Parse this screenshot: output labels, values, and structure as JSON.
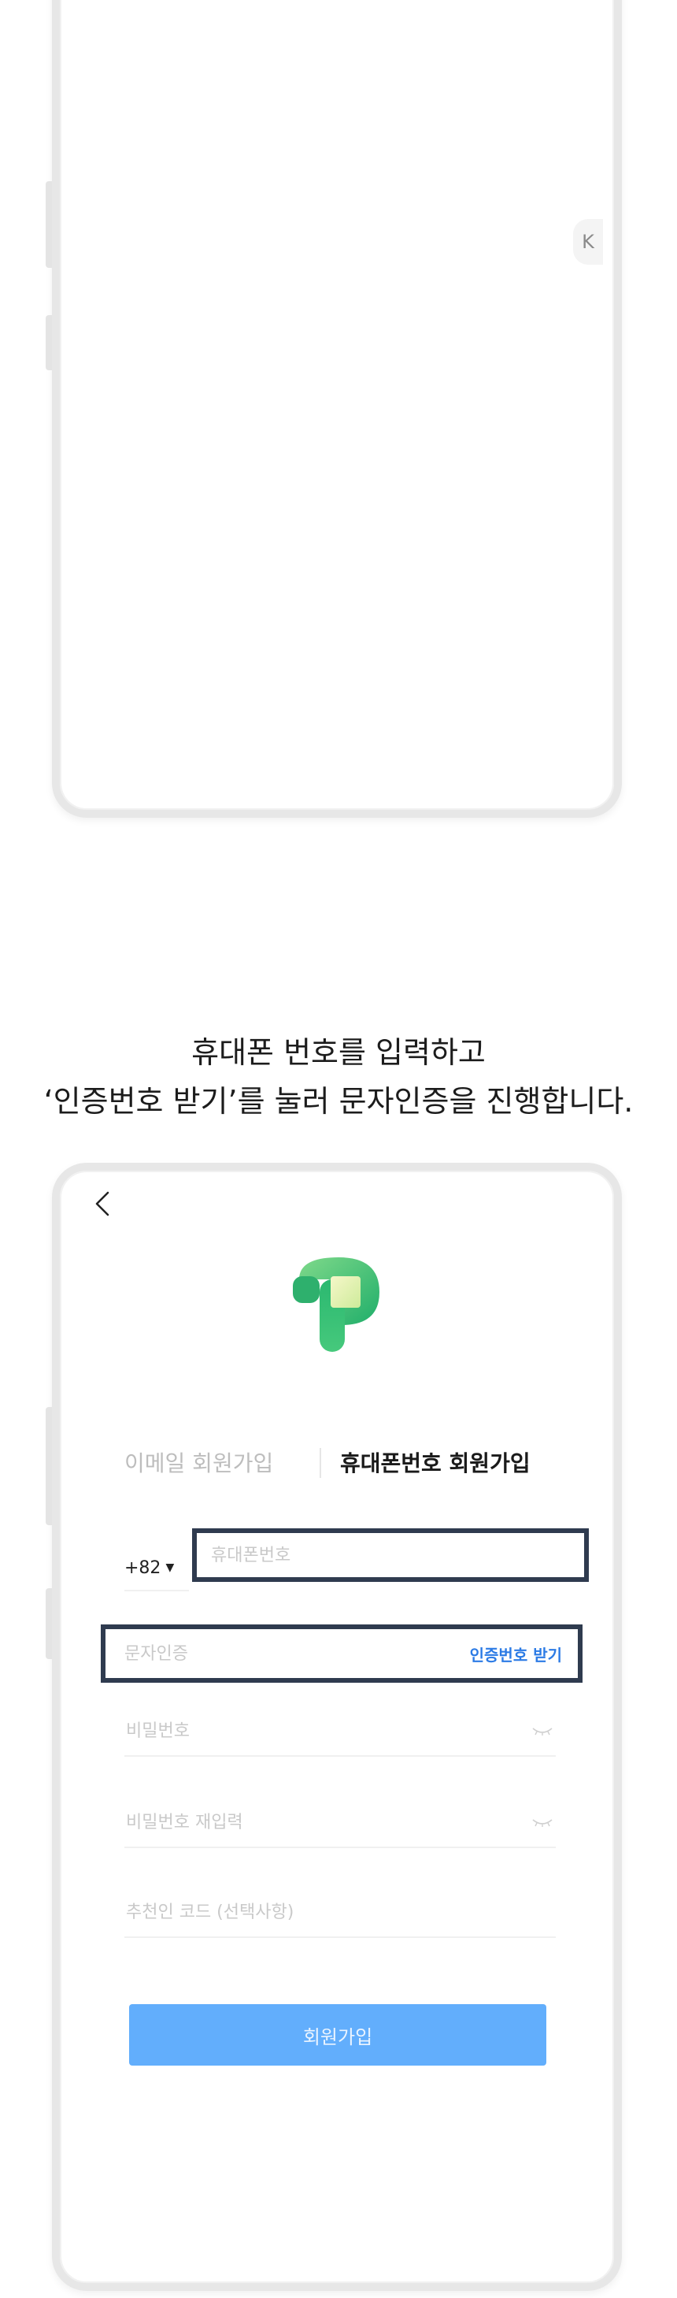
{
  "top_phone": {
    "side_tab_label": "K"
  },
  "caption": {
    "line1": "휴대폰 번호를 입력하고",
    "line2": "‘인증번호 받기’를 눌러 문자인증을 진행합니다."
  },
  "signup": {
    "tabs": {
      "email_label": "이메일 회원가입",
      "phone_label": "휴대폰번호 회원가입",
      "active": "phone"
    },
    "country_code": "+82",
    "phone_placeholder": "휴대폰번호",
    "sms_placeholder": "문자인증",
    "sms_button": "인증번호 받기",
    "password_placeholder": "비밀번호",
    "password_confirm_placeholder": "비밀번호 재입력",
    "referral_placeholder": "추천인 코드 (선택사항)",
    "submit_label": "회원가입"
  },
  "colors": {
    "accent_blue": "#2c7be5",
    "submit_bg": "#62aefc",
    "highlight_border": "#2f3b4f",
    "logo_green": "#3fbf73"
  },
  "icons": [
    "back-arrow-icon",
    "app-logo-icon",
    "caret-down-icon",
    "eye-closed-icon"
  ]
}
